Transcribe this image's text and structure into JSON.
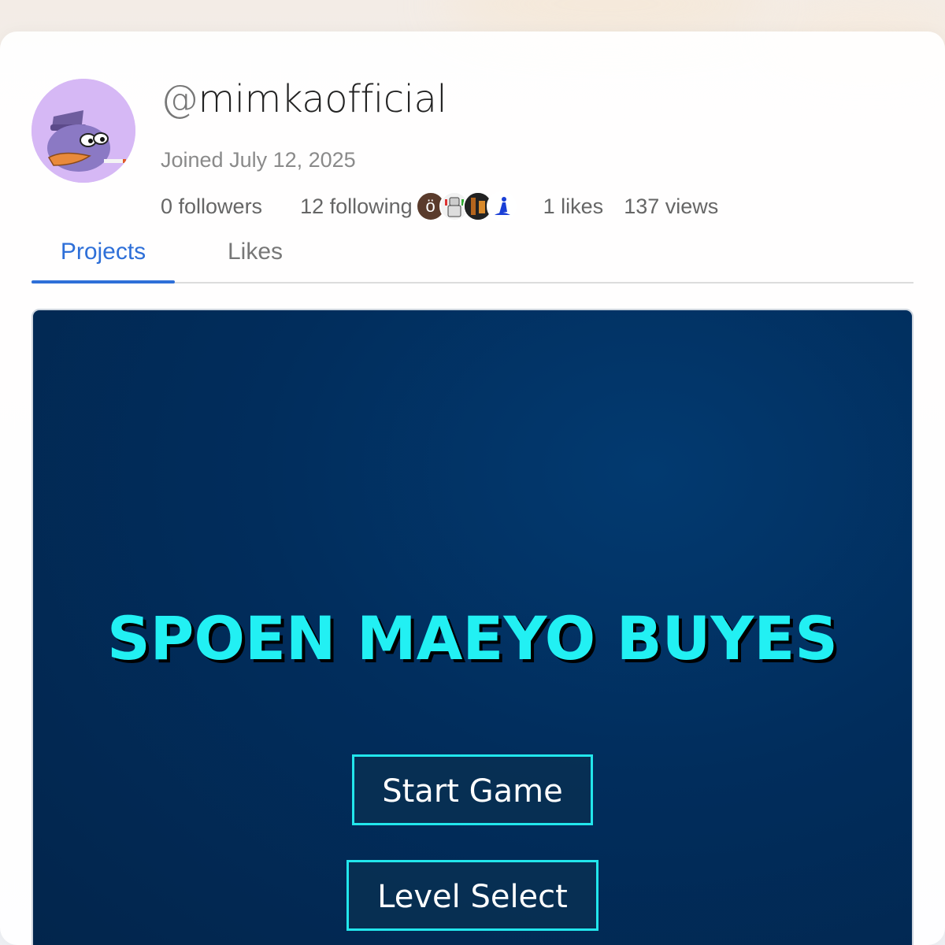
{
  "profile": {
    "username_prefix": "@",
    "username": "mimkaofficial",
    "joined": "Joined July 12, 2025",
    "avatar_icon": "cartoon-bird-avatar",
    "stats": {
      "followers": "0 followers",
      "following": "12 following",
      "likes": "1 likes",
      "views": "137 views"
    },
    "following_avatars": [
      {
        "icon": "letter-avatar",
        "text": "ö"
      },
      {
        "icon": "robot-avatar",
        "text": ""
      },
      {
        "icon": "dark-photo-avatar",
        "text": ""
      },
      {
        "icon": "blue-figure-avatar",
        "text": ""
      }
    ]
  },
  "tabs": [
    {
      "label": "Projects",
      "active": true
    },
    {
      "label": "Likes",
      "active": false
    }
  ],
  "project_preview": {
    "title": "SPOEN MAEYO BUYES",
    "buttons": {
      "start": "Start Game",
      "level_select": "Level Select"
    }
  },
  "colors": {
    "accent": "#2e6fd8",
    "game_title": "#22f0f3",
    "game_bg": "#012d5c",
    "avatar_bg": "#d6b8f5"
  }
}
